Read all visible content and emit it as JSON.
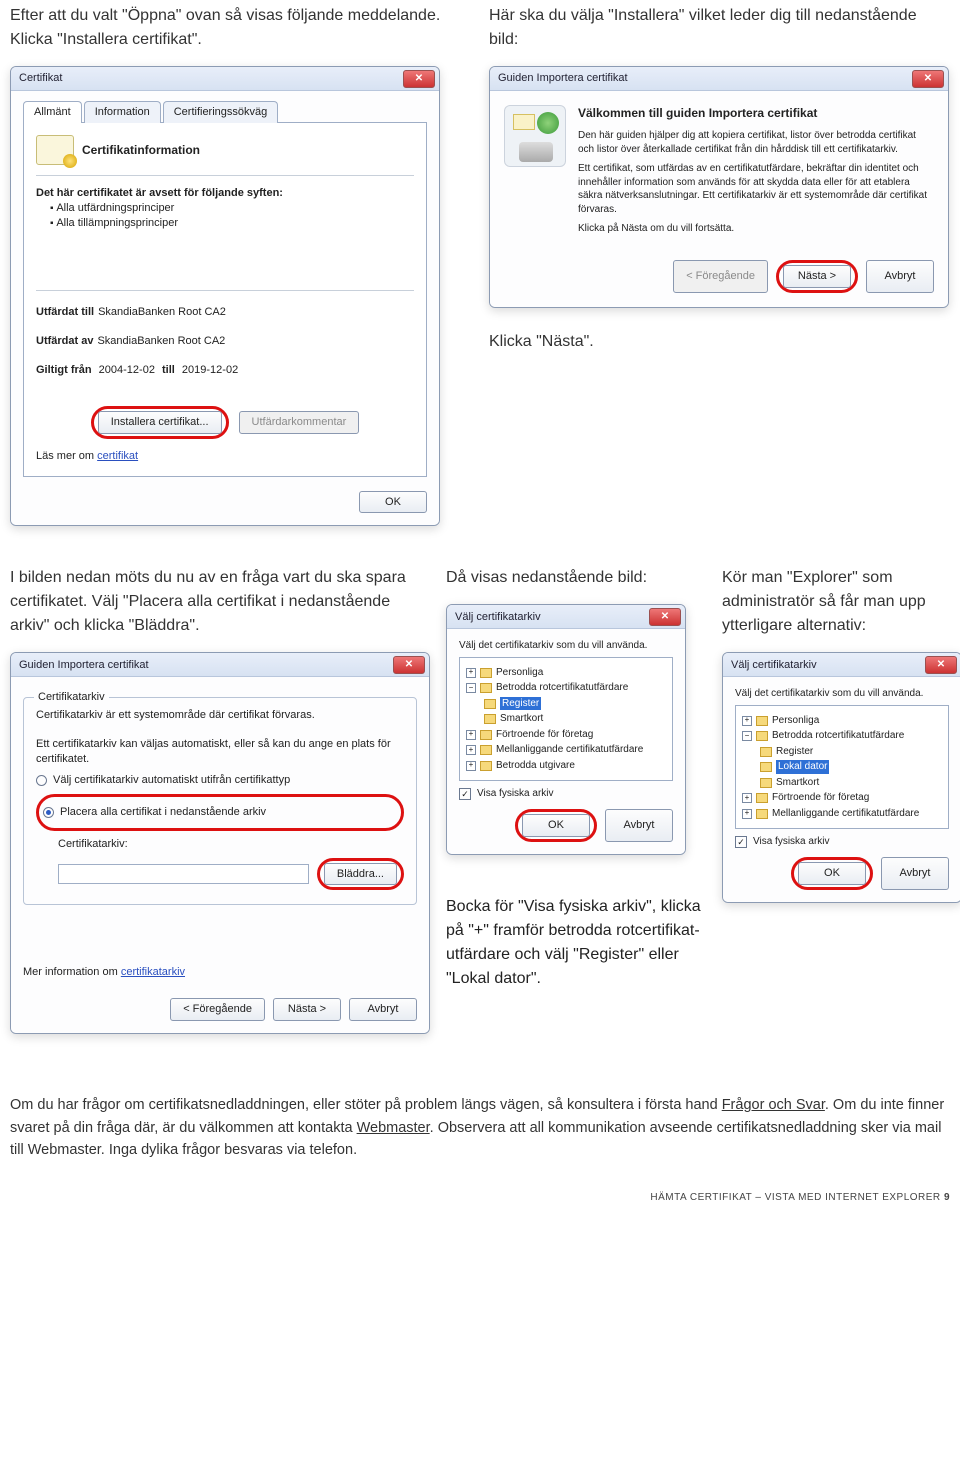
{
  "top": {
    "left_intro": "Efter att du valt \"Öppna\" ovan så visas följande meddelande. Klicka \"Installera certifikat\".",
    "right_intro": "Här ska du välja \"Installera\" vilket leder dig till nedanstående bild:",
    "klicka_nasta": "Klicka \"Nästa\"."
  },
  "cert_win": {
    "title": "Certifikat",
    "tabs": {
      "t1": "Allmänt",
      "t2": "Information",
      "t3": "Certifieringssökväg"
    },
    "info_hdr": "Certifikatinformation",
    "purpose_hdr": "Det här certifikatet är avsett för följande syften:",
    "purpose1": "Alla utfärdningsprinciper",
    "purpose2": "Alla tillämpningsprinciper",
    "issued_to_lbl": "Utfärdat till",
    "issued_to_val": "SkandiaBanken Root CA2",
    "issued_by_lbl": "Utfärdat av",
    "issued_by_val": "SkandiaBanken Root CA2",
    "valid_lbl1": "Giltigt från",
    "valid_from": "2004-12-02",
    "valid_lbl2": "till",
    "valid_to": "2019-12-02",
    "btn_install": "Installera certifikat...",
    "btn_comment": "Utfärdarkommentar",
    "more_lbl": "Läs mer om",
    "more_link": "certifikat",
    "ok": "OK"
  },
  "wizard": {
    "title": "Guiden Importera certifikat",
    "h": "Välkommen till guiden Importera certifikat",
    "p1": "Den här guiden hjälper dig att kopiera certifikat, listor över betrodda certifikat och listor över återkallade certifikat från din hårddisk till ett certifikatarkiv.",
    "p2": "Ett certifikat, som utfärdas av en certifikatutfärdare, bekräftar din identitet och innehåller information som används för att skydda data eller för att etablera säkra nätverksanslutningar. Ett certifikatarkiv är ett systemområde där certifikat förvaras.",
    "p3": "Klicka på Nästa om du vill fortsätta.",
    "back": "< Föregående",
    "next": "Nästa >",
    "cancel": "Avbryt"
  },
  "mid": {
    "c1": "I bilden nedan möts du nu av en fråga vart du ska spara certifikatet. Välj \"Placera alla certifikat i nedanstående arkiv\" och klicka \"Bläddra\".",
    "c2": "Då visas nedanstående bild:",
    "c3": "Kör man \"Explorer\" som administratör så får man upp ytterligare alternativ:"
  },
  "store_win": {
    "title": "Guiden Importera certifikat",
    "legend": "Certifikatarkiv",
    "desc": "Certifikatarkiv är ett systemområde där certifikat förvaras.",
    "desc2": "Ett certifikatarkiv kan väljas automatiskt, eller så kan du ange en plats för certifikatet.",
    "r1": "Välj certifikatarkiv automatiskt utifrån certifikattyp",
    "r2": "Placera alla certifikat i nedanstående arkiv",
    "store_lbl": "Certifikatarkiv:",
    "browse": "Bläddra...",
    "more_lbl": "Mer information om",
    "more_link": "certifikatarkiv",
    "back": "< Föregående",
    "next": "Nästa >",
    "cancel": "Avbryt"
  },
  "sel1": {
    "title": "Välj certifikatarkiv",
    "top": "Välj det certifikatarkiv som du vill använda.",
    "items": {
      "i1": "Personliga",
      "i2": "Betrodda rotcertifikatutfärdare",
      "i3": "Register",
      "i4": "Smartkort",
      "i5": "Förtroende för företag",
      "i6": "Mellanliggande certifikatutfärdare",
      "i7": "Betrodda utgivare"
    },
    "check": "Visa fysiska arkiv",
    "ok": "OK",
    "cancel": "Avbryt"
  },
  "sel2": {
    "title": "Välj certifikatarkiv",
    "top": "Välj det certifikatarkiv som du vill använda.",
    "items": {
      "i1": "Personliga",
      "i2": "Betrodda rotcertifikatutfärdare",
      "i3": "Register",
      "i4": "Lokal dator",
      "i5": "Smartkort",
      "i6": "Förtroende för företag",
      "i7": "Mellanliggande certifikatutfärdare"
    },
    "check": "Visa fysiska arkiv",
    "ok": "OK",
    "cancel": "Avbryt"
  },
  "tip": "Bocka för \"Visa fysiska arkiv\", klicka på \"+\" framför betrodda rotcertifikat­utfärdare och välj \"Register\" eller \"Lokal dator\".",
  "faq": {
    "l1a": "Om du har frågor om certifikatsnedladdningen, eller stöter på problem längs vägen, så konsultera i första hand ",
    "l1link": "Frågor och Svar",
    "l1b": ". Om du inte finner svaret på din fråga där, är du välkommen att kontakta ",
    "l2link": "Webmaster",
    "l2b": ". Observera att all kommunikation avseende certifikatsnedladdning sker via mail till Webmaster. Inga dylika frågor besvaras via telefon."
  },
  "footer": {
    "pre": "HÄMTA CERTIFIKAT – VISTA MED INTERNET EXPLORER",
    "page": "9"
  }
}
